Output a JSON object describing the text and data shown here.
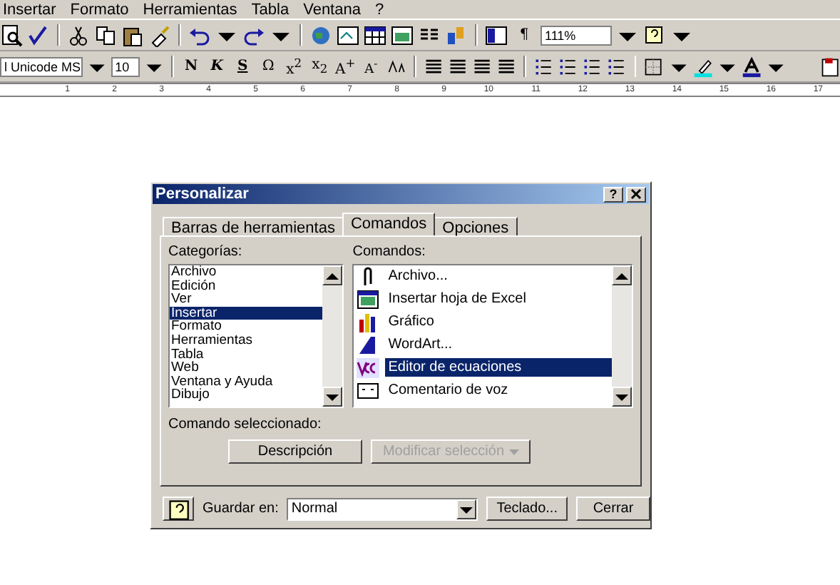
{
  "menu": [
    "Insertar",
    "Formato",
    "Herramientas",
    "Tabla",
    "Ventana",
    "?"
  ],
  "toolbar": {
    "pilcrow": "¶",
    "zoom": "111%"
  },
  "format_bar": {
    "font": "l Unicode MS",
    "size": "10",
    "buttons": [
      {
        "kind": "bold",
        "label": "N"
      },
      {
        "kind": "italic",
        "label": "K"
      },
      {
        "kind": "underline",
        "label": "S"
      },
      {
        "kind": "plain",
        "label": "Ω"
      },
      {
        "kind": "plain",
        "label": "x$^{2}$"
      },
      {
        "kind": "plain",
        "label": "x$_{2}$"
      },
      {
        "kind": "plain",
        "label": "A$^{+}$"
      },
      {
        "kind": "small",
        "label": "A$^{-}$"
      }
    ]
  },
  "ruler": [
    "1",
    "2",
    "3",
    "4",
    "5",
    "6",
    "7",
    "8",
    "9",
    "10",
    "11",
    "12",
    "13",
    "14",
    "15",
    "16",
    "17"
  ],
  "dialog": {
    "title": "Personalizar",
    "help": "?",
    "tabs": [
      {
        "label": "Barras de herramientas",
        "selected": false
      },
      {
        "label": "Comandos",
        "selected": true
      },
      {
        "label": "Opciones",
        "selected": false
      }
    ],
    "categories_label": "Categorías:",
    "categories": [
      {
        "label": "Archivo",
        "selected": false
      },
      {
        "label": "Edición",
        "selected": false
      },
      {
        "label": "Ver",
        "selected": false
      },
      {
        "label": "Insertar",
        "selected": true
      },
      {
        "label": "Formato",
        "selected": false
      },
      {
        "label": "Herramientas",
        "selected": false
      },
      {
        "label": "Tabla",
        "selected": false
      },
      {
        "label": "Web",
        "selected": false
      },
      {
        "label": "Ventana y Ayuda",
        "selected": false
      },
      {
        "label": "Dibujo",
        "selected": false
      }
    ],
    "commands_label": "Comandos:",
    "commands": [
      {
        "kind": "clip",
        "label": "Archivo...",
        "selected": false
      },
      {
        "kind": "sheet",
        "label": "Insertar hoja de Excel",
        "selected": false
      },
      {
        "kind": "chart",
        "label": "Gráfico",
        "selected": false
      },
      {
        "kind": "wordart",
        "label": "WordArt...",
        "selected": false
      },
      {
        "kind": "equation",
        "label": "Editor de ecuaciones",
        "selected": true
      },
      {
        "kind": "comment",
        "label": "Comentario de voz",
        "selected": false
      }
    ],
    "selected_label": "Comando seleccionado:",
    "description_button": {
      "label": "Descripción",
      "disabled": false
    },
    "modify_button": {
      "label": "Modificar selección",
      "disabled": true
    },
    "save_label": "Guardar en:",
    "save_value": "Normal",
    "keyboard_button": "Teclado...",
    "close_button": "Cerrar"
  }
}
